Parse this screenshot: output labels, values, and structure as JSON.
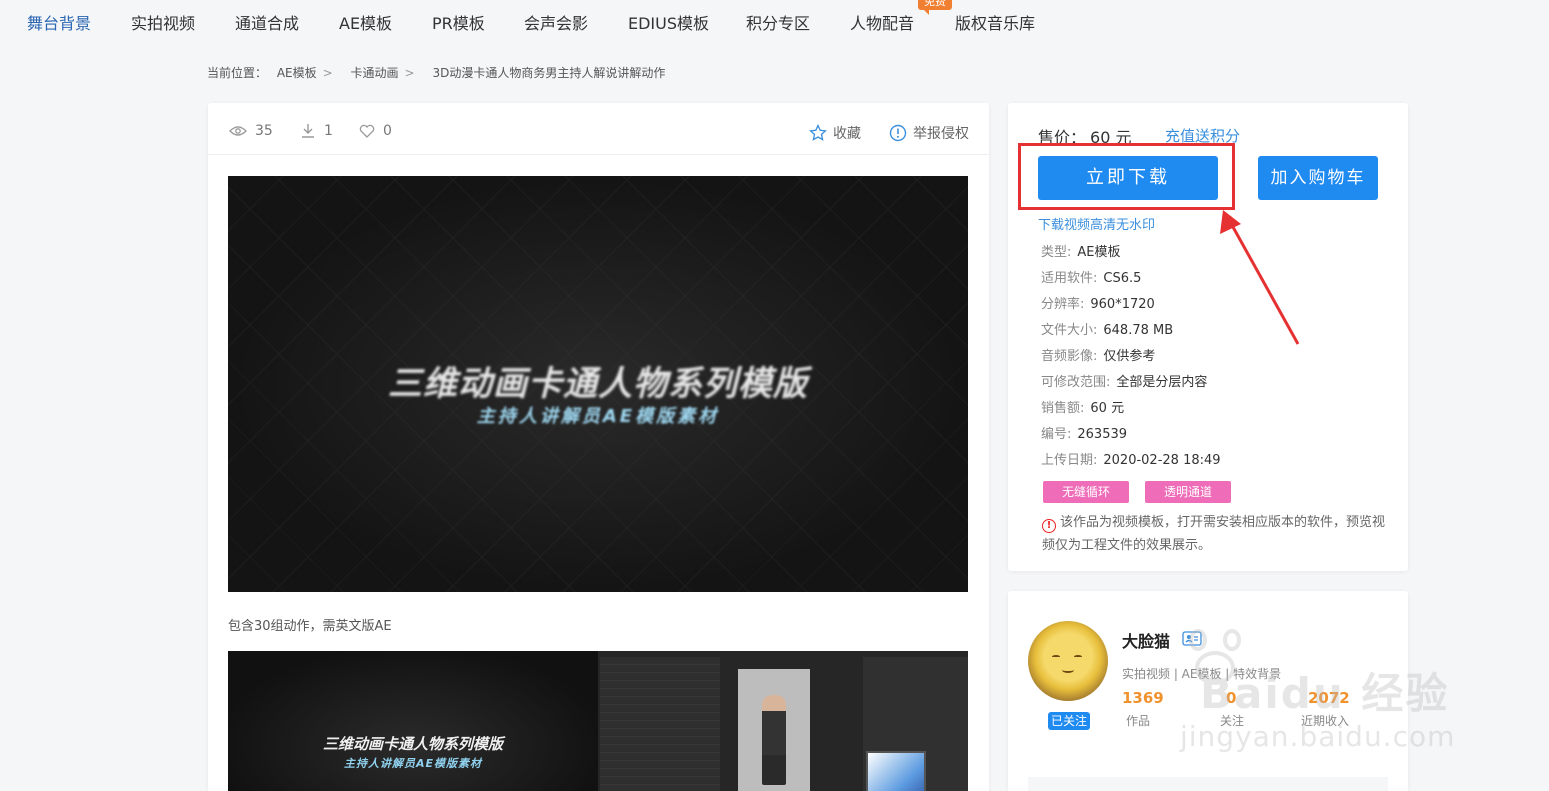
{
  "nav": {
    "items": [
      "舞台背景",
      "实拍视频",
      "通道合成",
      "AE模板",
      "PR模板",
      "会声会影",
      "EDIUS模板",
      "积分专区",
      "人物配音",
      "版权音乐库"
    ],
    "badge": "免费"
  },
  "breadcrumb": {
    "prefix": "当前位置：",
    "items": [
      "AE模板",
      "卡通动画",
      "3D动漫卡通人物商务男主持人解说讲解动作"
    ],
    "sep": ">"
  },
  "stats": {
    "views": "35",
    "downloads": "1",
    "likes": "0",
    "favorite_label": "收藏",
    "report_label": "举报侵权"
  },
  "preview": {
    "title": "三维动画卡通人物系列模版",
    "subtitle": "主持人讲解员AE模版素材",
    "description": "包含30组动作，需英文版AE",
    "title2": "三维动画卡通人物系列模版",
    "subtitle2": "主持人讲解员AE模版素材"
  },
  "purchase": {
    "price_label": "售价：",
    "price_value": "60 元",
    "recharge_link": "充值送积分",
    "download_button": "立即下载",
    "cart_button": "加入购物车",
    "hd_link": "下载视频高清无水印"
  },
  "info": [
    {
      "label": "类型:",
      "value": "AE模板"
    },
    {
      "label": "适用软件:",
      "value": "CS6.5"
    },
    {
      "label": "分辨率:",
      "value": "960*1720"
    },
    {
      "label": "文件大小:",
      "value": "648.78 MB"
    },
    {
      "label": "音频影像:",
      "value": "仅供参考"
    },
    {
      "label": "可修改范围:",
      "value": "全部是分层内容"
    },
    {
      "label": "销售额:",
      "value": "60 元"
    },
    {
      "label": "编号:",
      "value": "263539"
    },
    {
      "label": "上传日期:",
      "value": "2020-02-28 18:49"
    }
  ],
  "tags": [
    "无缝循环",
    "透明通道"
  ],
  "notice": "该作品为视频模板，打开需安装相应版本的软件，预览视频仅为工程文件的效果展示。",
  "author": {
    "name": "大脸猫",
    "followed_label": "已关注",
    "categories": "实拍视频 | AE模板 | 特效背景",
    "stats": [
      {
        "num": "1369",
        "label": "作品"
      },
      {
        "num": "0",
        "label": "关注"
      },
      {
        "num": "2072",
        "label": "近期收入"
      }
    ]
  },
  "watermark": {
    "text": "Baidu 经验",
    "url": "jingyan.baidu.com"
  },
  "colors": {
    "primary": "#1f8af0",
    "link": "#3b8fdc",
    "highlight": "#e53131",
    "tag": "#ef6db8",
    "accent_num": "#f0922e"
  }
}
